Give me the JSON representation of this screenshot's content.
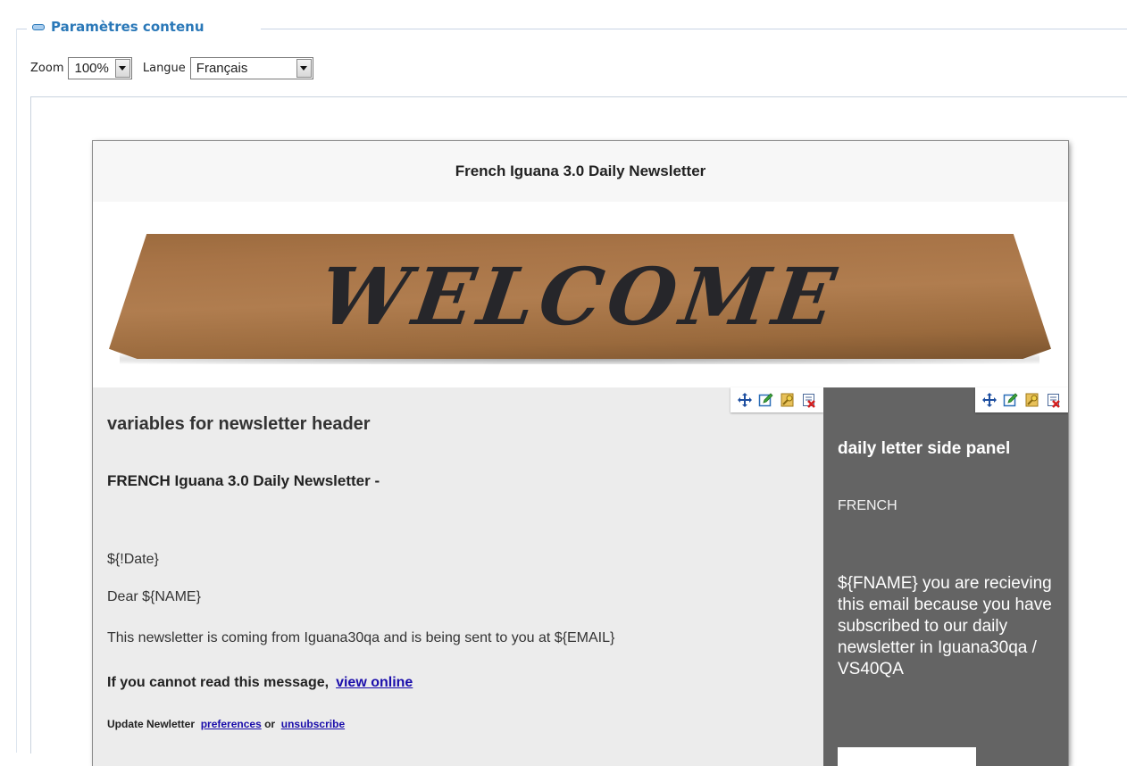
{
  "panel": {
    "legend": "Paramètres contenu"
  },
  "controls": {
    "zoom_label": "Zoom",
    "zoom_value": "100%",
    "language_label": "Langue",
    "language_value": "Français"
  },
  "newsletter": {
    "header_title": "French Iguana 3.0  Daily Newsletter",
    "banner_text": "WELCOME",
    "main": {
      "title": "variables for newsletter header",
      "subtitle": "FRENCH Iguana 3.0 Daily Newsletter  -",
      "date_var": "${!Date}",
      "greeting": "Dear ${NAME}",
      "intro": "This newsletter is coming from Iguana30qa and is being sent to you at ${EMAIL}",
      "cannot_read": "If you cannot read this message,",
      "view_online": "view online ",
      "update_prefix": "Update Newletter",
      "preferences_link": "preferences",
      "or_text": "or",
      "unsubscribe_link": "unsubscribe"
    },
    "side": {
      "title": "daily letter side panel",
      "french": "FRENCH",
      "body": "${FNAME} you are recieving this email because you have subscribed to our daily newsletter in Iguana30qa / VS40QA"
    }
  },
  "icons": [
    "move-icon",
    "edit-icon",
    "properties-icon",
    "delete-icon"
  ]
}
